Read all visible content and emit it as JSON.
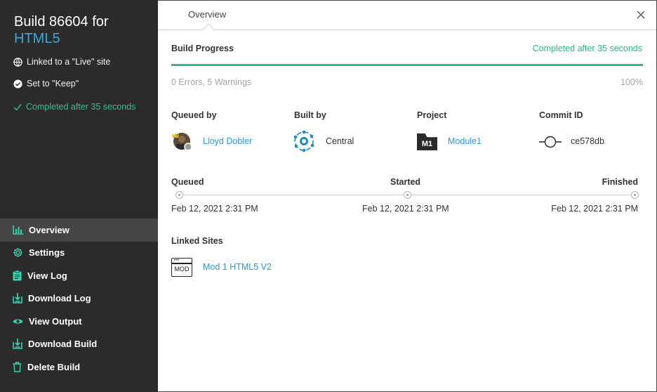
{
  "sidebar": {
    "title": "Build 86604 for",
    "app_name": "HTML5",
    "linked_site": "Linked to a \"Live\" site",
    "keep": "Set to \"Keep\"",
    "completed": "Completed after 35 seconds",
    "nav": [
      {
        "label": "Overview",
        "icon": "bar-chart-icon",
        "active": true
      },
      {
        "label": "Settings",
        "icon": "gear-icon"
      },
      {
        "label": "View Log",
        "icon": "clipboard-icon"
      },
      {
        "label": "Download Log",
        "icon": "download-icon"
      },
      {
        "label": "View Output",
        "icon": "eye-icon"
      },
      {
        "label": "Download Build",
        "icon": "download-icon"
      },
      {
        "label": "Delete Build",
        "icon": "trash-icon"
      }
    ]
  },
  "header": {
    "tab": "Overview",
    "close_icon": "close-icon"
  },
  "progress": {
    "title": "Build Progress",
    "status": "Completed after 35 seconds",
    "errors_warnings": "0 Errors, 5 Warnings",
    "percent_label": "100%",
    "percent": 100
  },
  "details": {
    "queued_by_label": "Queued by",
    "queued_by": "Lloyd Dobler",
    "built_by_label": "Built by",
    "built_by": "Central",
    "project_label": "Project",
    "project_badge": "M1",
    "project": "Module1",
    "commit_label": "Commit ID",
    "commit": "ce578db"
  },
  "timeline": {
    "queued_label": "Queued",
    "queued": "Feb 12, 2021 2:31 PM",
    "started_label": "Started",
    "started": "Feb 12, 2021 2:31 PM",
    "finished_label": "Finished",
    "finished": "Feb 12, 2021 2:31 PM"
  },
  "linked_sites": {
    "title": "Linked Sites",
    "icon_label": "MOD",
    "site": "Mod 1 HTML5 V2"
  },
  "colors": {
    "sidebar_bg": "#2b2b2b",
    "accent_green": "#2fb58a",
    "link_blue": "#2f97d1",
    "nav_icon": "#35d6b2"
  }
}
